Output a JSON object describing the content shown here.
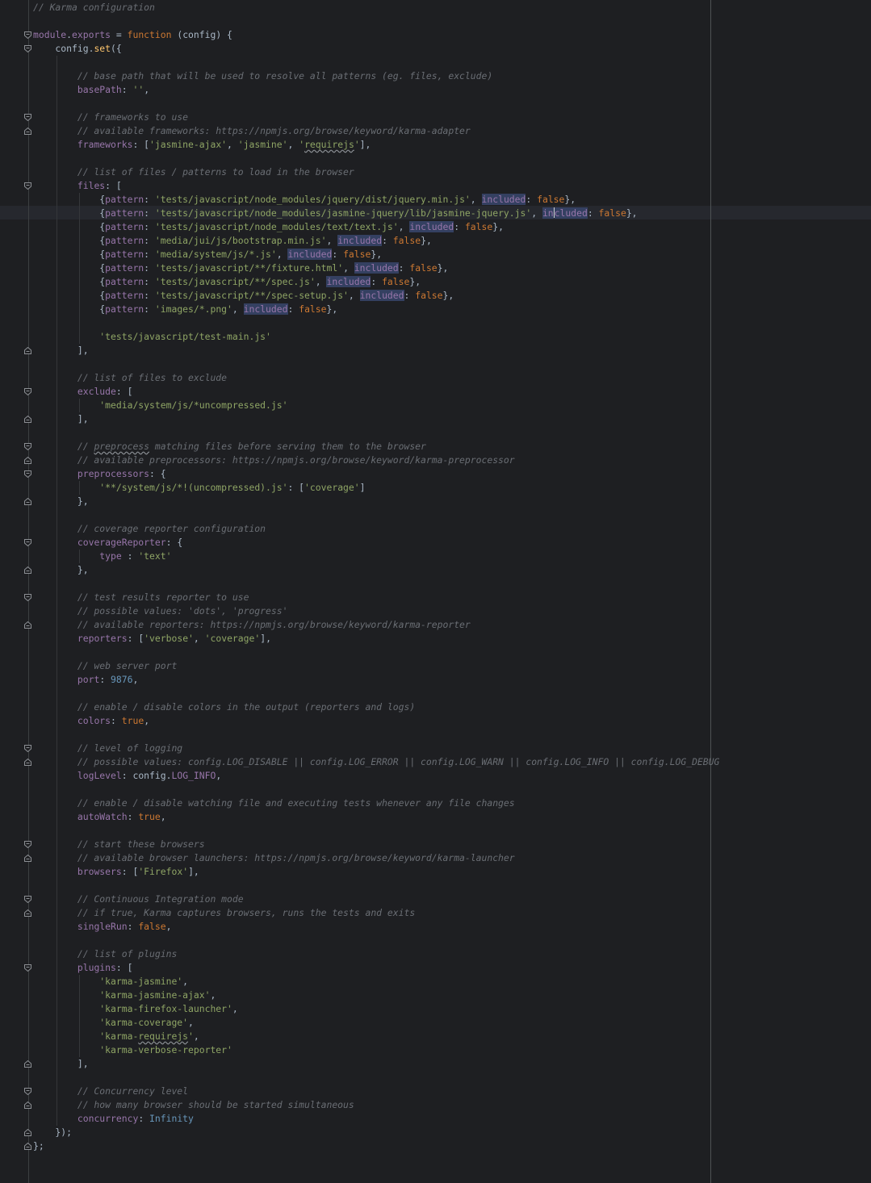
{
  "editor": {
    "lines": [
      [
        [
          "c",
          "// Karma configuration"
        ]
      ],
      [],
      [
        [
          "p",
          "module"
        ],
        [
          "t",
          "."
        ],
        [
          "p",
          "exports"
        ],
        [
          "t",
          " = "
        ],
        [
          "k",
          "function"
        ],
        [
          "t",
          " (config) {"
        ]
      ],
      [
        [
          "t",
          "    config."
        ],
        [
          "f",
          "set"
        ],
        [
          "t",
          "({"
        ]
      ],
      [],
      [
        [
          "c",
          "        // base path that will be used to resolve all patterns (eg. files, exclude)"
        ]
      ],
      [
        [
          "t",
          "        "
        ],
        [
          "p",
          "basePath"
        ],
        [
          "t",
          ": "
        ],
        [
          "s",
          "''"
        ],
        [
          "t",
          ","
        ]
      ],
      [],
      [
        [
          "c",
          "        // frameworks to use"
        ]
      ],
      [
        [
          "c",
          "        // available frameworks: https://npmjs.org/browse/keyword/karma-adapter"
        ]
      ],
      [
        [
          "t",
          "        "
        ],
        [
          "p",
          "frameworks"
        ],
        [
          "t",
          ": ["
        ],
        [
          "s",
          "'jasmine-ajax'"
        ],
        [
          "t",
          ", "
        ],
        [
          "s",
          "'jasmine'"
        ],
        [
          "t",
          ", "
        ],
        [
          "s",
          "'"
        ],
        [
          "s sq",
          "requirejs"
        ],
        [
          "s",
          "'"
        ],
        [
          "t",
          "],"
        ]
      ],
      [],
      [
        [
          "c",
          "        // list of files / patterns to load in the browser"
        ]
      ],
      [
        [
          "t",
          "        "
        ],
        [
          "p",
          "files"
        ],
        [
          "t",
          ": ["
        ]
      ],
      [
        [
          "t",
          "            {"
        ],
        [
          "p",
          "pattern"
        ],
        [
          "t",
          ": "
        ],
        [
          "s",
          "'tests/javascript/node_modules/jquery/dist/jquery.min.js'"
        ],
        [
          "t",
          ", "
        ],
        [
          "p hl",
          "included"
        ],
        [
          "t",
          ": "
        ],
        [
          "k",
          "false"
        ],
        [
          "t",
          "},"
        ]
      ],
      [
        [
          "t",
          "            {"
        ],
        [
          "p",
          "pattern"
        ],
        [
          "t",
          ": "
        ],
        [
          "s",
          "'tests/javascript/node_modules/jasmine-jquery/lib/jasmine-jquery.js'"
        ],
        [
          "t",
          ", "
        ],
        [
          "p hl",
          "in"
        ],
        [
          "caret",
          ""
        ],
        [
          "p hl",
          "cluded"
        ],
        [
          "t",
          ": "
        ],
        [
          "k",
          "false"
        ],
        [
          "t",
          "},"
        ]
      ],
      [
        [
          "t",
          "            {"
        ],
        [
          "p",
          "pattern"
        ],
        [
          "t",
          ": "
        ],
        [
          "s",
          "'tests/javascript/node_modules/text/text.js'"
        ],
        [
          "t",
          ", "
        ],
        [
          "p hl",
          "included"
        ],
        [
          "t",
          ": "
        ],
        [
          "k",
          "false"
        ],
        [
          "t",
          "},"
        ]
      ],
      [
        [
          "t",
          "            {"
        ],
        [
          "p",
          "pattern"
        ],
        [
          "t",
          ": "
        ],
        [
          "s",
          "'media/jui/js/bootstrap.min.js'"
        ],
        [
          "t",
          ", "
        ],
        [
          "p hl",
          "included"
        ],
        [
          "t",
          ": "
        ],
        [
          "k",
          "false"
        ],
        [
          "t",
          "},"
        ]
      ],
      [
        [
          "t",
          "            {"
        ],
        [
          "p",
          "pattern"
        ],
        [
          "t",
          ": "
        ],
        [
          "s",
          "'media/system/js/*.js'"
        ],
        [
          "t",
          ", "
        ],
        [
          "p hl",
          "included"
        ],
        [
          "t",
          ": "
        ],
        [
          "k",
          "false"
        ],
        [
          "t",
          "},"
        ]
      ],
      [
        [
          "t",
          "            {"
        ],
        [
          "p",
          "pattern"
        ],
        [
          "t",
          ": "
        ],
        [
          "s",
          "'tests/javascript/**/fixture.html'"
        ],
        [
          "t",
          ", "
        ],
        [
          "p hl",
          "included"
        ],
        [
          "t",
          ": "
        ],
        [
          "k",
          "false"
        ],
        [
          "t",
          "},"
        ]
      ],
      [
        [
          "t",
          "            {"
        ],
        [
          "p",
          "pattern"
        ],
        [
          "t",
          ": "
        ],
        [
          "s",
          "'tests/javascript/**/spec.js'"
        ],
        [
          "t",
          ", "
        ],
        [
          "p hl",
          "included"
        ],
        [
          "t",
          ": "
        ],
        [
          "k",
          "false"
        ],
        [
          "t",
          "},"
        ]
      ],
      [
        [
          "t",
          "            {"
        ],
        [
          "p",
          "pattern"
        ],
        [
          "t",
          ": "
        ],
        [
          "s",
          "'tests/javascript/**/spec-setup.js'"
        ],
        [
          "t",
          ", "
        ],
        [
          "p hl",
          "included"
        ],
        [
          "t",
          ": "
        ],
        [
          "k",
          "false"
        ],
        [
          "t",
          "},"
        ]
      ],
      [
        [
          "t",
          "            {"
        ],
        [
          "p",
          "pattern"
        ],
        [
          "t",
          ": "
        ],
        [
          "s",
          "'images/*.png'"
        ],
        [
          "t",
          ", "
        ],
        [
          "p hl",
          "included"
        ],
        [
          "t",
          ": "
        ],
        [
          "k",
          "false"
        ],
        [
          "t",
          "},"
        ]
      ],
      [],
      [
        [
          "t",
          "            "
        ],
        [
          "s",
          "'tests/javascript/test-main.js'"
        ]
      ],
      [
        [
          "t",
          "        ],"
        ]
      ],
      [],
      [
        [
          "c",
          "        // list of files to exclude"
        ]
      ],
      [
        [
          "t",
          "        "
        ],
        [
          "p",
          "exclude"
        ],
        [
          "t",
          ": ["
        ]
      ],
      [
        [
          "t",
          "            "
        ],
        [
          "s",
          "'media/system/js/*uncompressed.js'"
        ]
      ],
      [
        [
          "t",
          "        ],"
        ]
      ],
      [],
      [
        [
          "c",
          "        // "
        ],
        [
          "c sq",
          "preprocess"
        ],
        [
          "c",
          " matching files before serving them to the browser"
        ]
      ],
      [
        [
          "c",
          "        // available preprocessors: https://npmjs.org/browse/keyword/karma-preprocessor"
        ]
      ],
      [
        [
          "t",
          "        "
        ],
        [
          "p",
          "preprocessors"
        ],
        [
          "t",
          ": {"
        ]
      ],
      [
        [
          "t",
          "            "
        ],
        [
          "s",
          "'**/system/js/*!(uncompressed).js'"
        ],
        [
          "t",
          ": ["
        ],
        [
          "s",
          "'coverage'"
        ],
        [
          "t",
          "]"
        ]
      ],
      [
        [
          "t",
          "        },"
        ]
      ],
      [],
      [
        [
          "c",
          "        // coverage reporter configuration"
        ]
      ],
      [
        [
          "t",
          "        "
        ],
        [
          "p",
          "coverageReporter"
        ],
        [
          "t",
          ": {"
        ]
      ],
      [
        [
          "t",
          "            "
        ],
        [
          "p",
          "type"
        ],
        [
          "t",
          " : "
        ],
        [
          "s",
          "'text'"
        ]
      ],
      [
        [
          "t",
          "        },"
        ]
      ],
      [],
      [
        [
          "c",
          "        // test results reporter to use"
        ]
      ],
      [
        [
          "c",
          "        // possible values: 'dots', 'progress'"
        ]
      ],
      [
        [
          "c",
          "        // available reporters: https://npmjs.org/browse/keyword/karma-reporter"
        ]
      ],
      [
        [
          "t",
          "        "
        ],
        [
          "p",
          "reporters"
        ],
        [
          "t",
          ": ["
        ],
        [
          "s",
          "'verbose'"
        ],
        [
          "t",
          ", "
        ],
        [
          "s",
          "'coverage'"
        ],
        [
          "t",
          "],"
        ]
      ],
      [],
      [
        [
          "c",
          "        // web server port"
        ]
      ],
      [
        [
          "t",
          "        "
        ],
        [
          "p",
          "port"
        ],
        [
          "t",
          ": "
        ],
        [
          "n",
          "9876"
        ],
        [
          "t",
          ","
        ]
      ],
      [],
      [
        [
          "c",
          "        // enable / disable colors in the output (reporters and logs)"
        ]
      ],
      [
        [
          "t",
          "        "
        ],
        [
          "p",
          "colors"
        ],
        [
          "t",
          ": "
        ],
        [
          "k",
          "true"
        ],
        [
          "t",
          ","
        ]
      ],
      [],
      [
        [
          "c",
          "        // level of logging"
        ]
      ],
      [
        [
          "c",
          "        // possible values: config.LOG_DISABLE || config.LOG_ERROR || config.LOG_WARN || config.LOG_INFO || config.LOG_DEBUG"
        ]
      ],
      [
        [
          "t",
          "        "
        ],
        [
          "p",
          "logLevel"
        ],
        [
          "t",
          ": config."
        ],
        [
          "p",
          "LOG_INFO"
        ],
        [
          "t",
          ","
        ]
      ],
      [],
      [
        [
          "c",
          "        // enable / disable watching file and executing tests whenever any file changes"
        ]
      ],
      [
        [
          "t",
          "        "
        ],
        [
          "p",
          "autoWatch"
        ],
        [
          "t",
          ": "
        ],
        [
          "k",
          "true"
        ],
        [
          "t",
          ","
        ]
      ],
      [],
      [
        [
          "c",
          "        // start these browsers"
        ]
      ],
      [
        [
          "c",
          "        // available browser launchers: https://npmjs.org/browse/keyword/karma-launcher"
        ]
      ],
      [
        [
          "t",
          "        "
        ],
        [
          "p",
          "browsers"
        ],
        [
          "t",
          ": ["
        ],
        [
          "s",
          "'Firefox'"
        ],
        [
          "t",
          "],"
        ]
      ],
      [],
      [
        [
          "c",
          "        // Continuous Integration mode"
        ]
      ],
      [
        [
          "c",
          "        // if true, Karma captures browsers, runs the tests and exits"
        ]
      ],
      [
        [
          "t",
          "        "
        ],
        [
          "p",
          "singleRun"
        ],
        [
          "t",
          ": "
        ],
        [
          "k",
          "false"
        ],
        [
          "t",
          ","
        ]
      ],
      [],
      [
        [
          "c",
          "        // list of plugins"
        ]
      ],
      [
        [
          "t",
          "        "
        ],
        [
          "p",
          "plugins"
        ],
        [
          "t",
          ": ["
        ]
      ],
      [
        [
          "t",
          "            "
        ],
        [
          "s",
          "'karma-jasmine'"
        ],
        [
          "t",
          ","
        ]
      ],
      [
        [
          "t",
          "            "
        ],
        [
          "s",
          "'karma-jasmine-ajax'"
        ],
        [
          "t",
          ","
        ]
      ],
      [
        [
          "t",
          "            "
        ],
        [
          "s",
          "'karma-firefox-launcher'"
        ],
        [
          "t",
          ","
        ]
      ],
      [
        [
          "t",
          "            "
        ],
        [
          "s",
          "'karma-coverage'"
        ],
        [
          "t",
          ","
        ]
      ],
      [
        [
          "t",
          "            "
        ],
        [
          "s",
          "'karma-"
        ],
        [
          "s sq",
          "requirejs"
        ],
        [
          "s",
          "'"
        ],
        [
          "t",
          ","
        ]
      ],
      [
        [
          "t",
          "            "
        ],
        [
          "s",
          "'karma-verbose-reporter'"
        ]
      ],
      [
        [
          "t",
          "        ],"
        ]
      ],
      [],
      [
        [
          "c",
          "        // Concurrency level"
        ]
      ],
      [
        [
          "c",
          "        // how many browser should be started simultaneous"
        ]
      ],
      [
        [
          "t",
          "        "
        ],
        [
          "p",
          "concurrency"
        ],
        [
          "t",
          ": "
        ],
        [
          "n",
          "Infinity"
        ]
      ],
      [
        [
          "t",
          "    });"
        ]
      ],
      [
        [
          "t",
          "};"
        ]
      ]
    ]
  }
}
